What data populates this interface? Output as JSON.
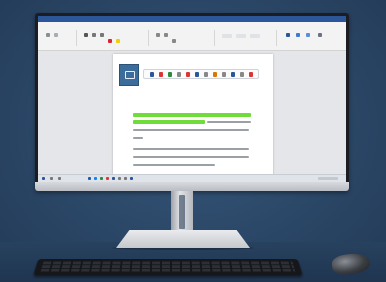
{
  "scene": {
    "description_visible_text": ""
  },
  "app": {
    "window_title": ""
  },
  "colors": {
    "ribbon_accent": "#2b579a",
    "highlight": "#6fdc3a",
    "wall": "#2d4a6b"
  },
  "icons": {
    "document_logo": "document-logo-icon",
    "mouse": "mouse-icon",
    "keyboard": "keyboard-icon"
  }
}
